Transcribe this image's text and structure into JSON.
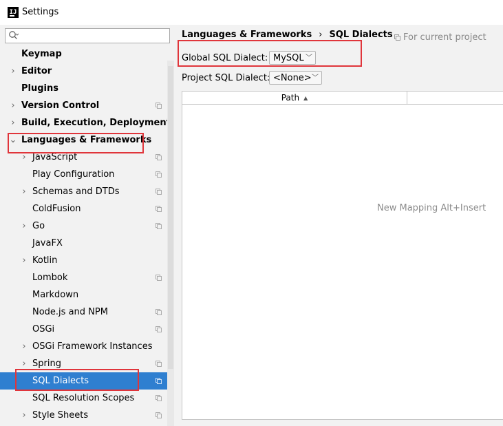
{
  "window": {
    "title": "Settings",
    "logo_text": "IJ"
  },
  "sidebar": {
    "search_placeholder": "",
    "items": [
      {
        "label": "Keymap",
        "bold": true,
        "level": 0,
        "expander": "none",
        "copy_icon": false
      },
      {
        "label": "Editor",
        "bold": true,
        "level": 0,
        "expander": "collapsed",
        "copy_icon": false
      },
      {
        "label": "Plugins",
        "bold": true,
        "level": 0,
        "expander": "none",
        "copy_icon": false
      },
      {
        "label": "Version Control",
        "bold": true,
        "level": 0,
        "expander": "collapsed",
        "copy_icon": true
      },
      {
        "label": "Build, Execution, Deployment",
        "bold": true,
        "level": 0,
        "expander": "collapsed",
        "copy_icon": false
      },
      {
        "label": "Languages & Frameworks",
        "bold": true,
        "level": 0,
        "expander": "expanded",
        "copy_icon": false
      },
      {
        "label": "JavaScript",
        "bold": false,
        "level": 1,
        "expander": "collapsed",
        "copy_icon": true
      },
      {
        "label": "Play Configuration",
        "bold": false,
        "level": 1,
        "expander": "none",
        "copy_icon": true
      },
      {
        "label": "Schemas and DTDs",
        "bold": false,
        "level": 1,
        "expander": "collapsed",
        "copy_icon": true
      },
      {
        "label": "ColdFusion",
        "bold": false,
        "level": 1,
        "expander": "none",
        "copy_icon": true
      },
      {
        "label": "Go",
        "bold": false,
        "level": 1,
        "expander": "collapsed",
        "copy_icon": true
      },
      {
        "label": "JavaFX",
        "bold": false,
        "level": 1,
        "expander": "none",
        "copy_icon": false
      },
      {
        "label": "Kotlin",
        "bold": false,
        "level": 1,
        "expander": "collapsed",
        "copy_icon": false
      },
      {
        "label": "Lombok",
        "bold": false,
        "level": 1,
        "expander": "none",
        "copy_icon": true
      },
      {
        "label": "Markdown",
        "bold": false,
        "level": 1,
        "expander": "none",
        "copy_icon": false
      },
      {
        "label": "Node.js and NPM",
        "bold": false,
        "level": 1,
        "expander": "none",
        "copy_icon": true
      },
      {
        "label": "OSGi",
        "bold": false,
        "level": 1,
        "expander": "none",
        "copy_icon": true
      },
      {
        "label": "OSGi Framework Instances",
        "bold": false,
        "level": 1,
        "expander": "collapsed",
        "copy_icon": false
      },
      {
        "label": "Spring",
        "bold": false,
        "level": 1,
        "expander": "collapsed",
        "copy_icon": true
      },
      {
        "label": "SQL Dialects",
        "bold": false,
        "level": 1,
        "expander": "none",
        "copy_icon": true,
        "selected": true
      },
      {
        "label": "SQL Resolution Scopes",
        "bold": false,
        "level": 1,
        "expander": "none",
        "copy_icon": true
      },
      {
        "label": "Style Sheets",
        "bold": false,
        "level": 1,
        "expander": "collapsed",
        "copy_icon": true
      }
    ]
  },
  "panel": {
    "breadcrumb": {
      "parent": "Languages & Frameworks",
      "separator": "›",
      "current": "SQL Dialects"
    },
    "scope_note": "For current project",
    "global_dialect": {
      "label": "Global SQL Dialect:",
      "value": "MySQL"
    },
    "project_dialect": {
      "label": "Project SQL Dialect:",
      "value": "<None>"
    },
    "table": {
      "columns": [
        {
          "label": "Path",
          "sort": "ascending"
        }
      ],
      "rows": [],
      "empty_text": "New Mapping Alt+Insert"
    }
  },
  "colors": {
    "selection": "#2f7fd0",
    "annotation": "#e0353b",
    "background": "#f2f2f2"
  }
}
